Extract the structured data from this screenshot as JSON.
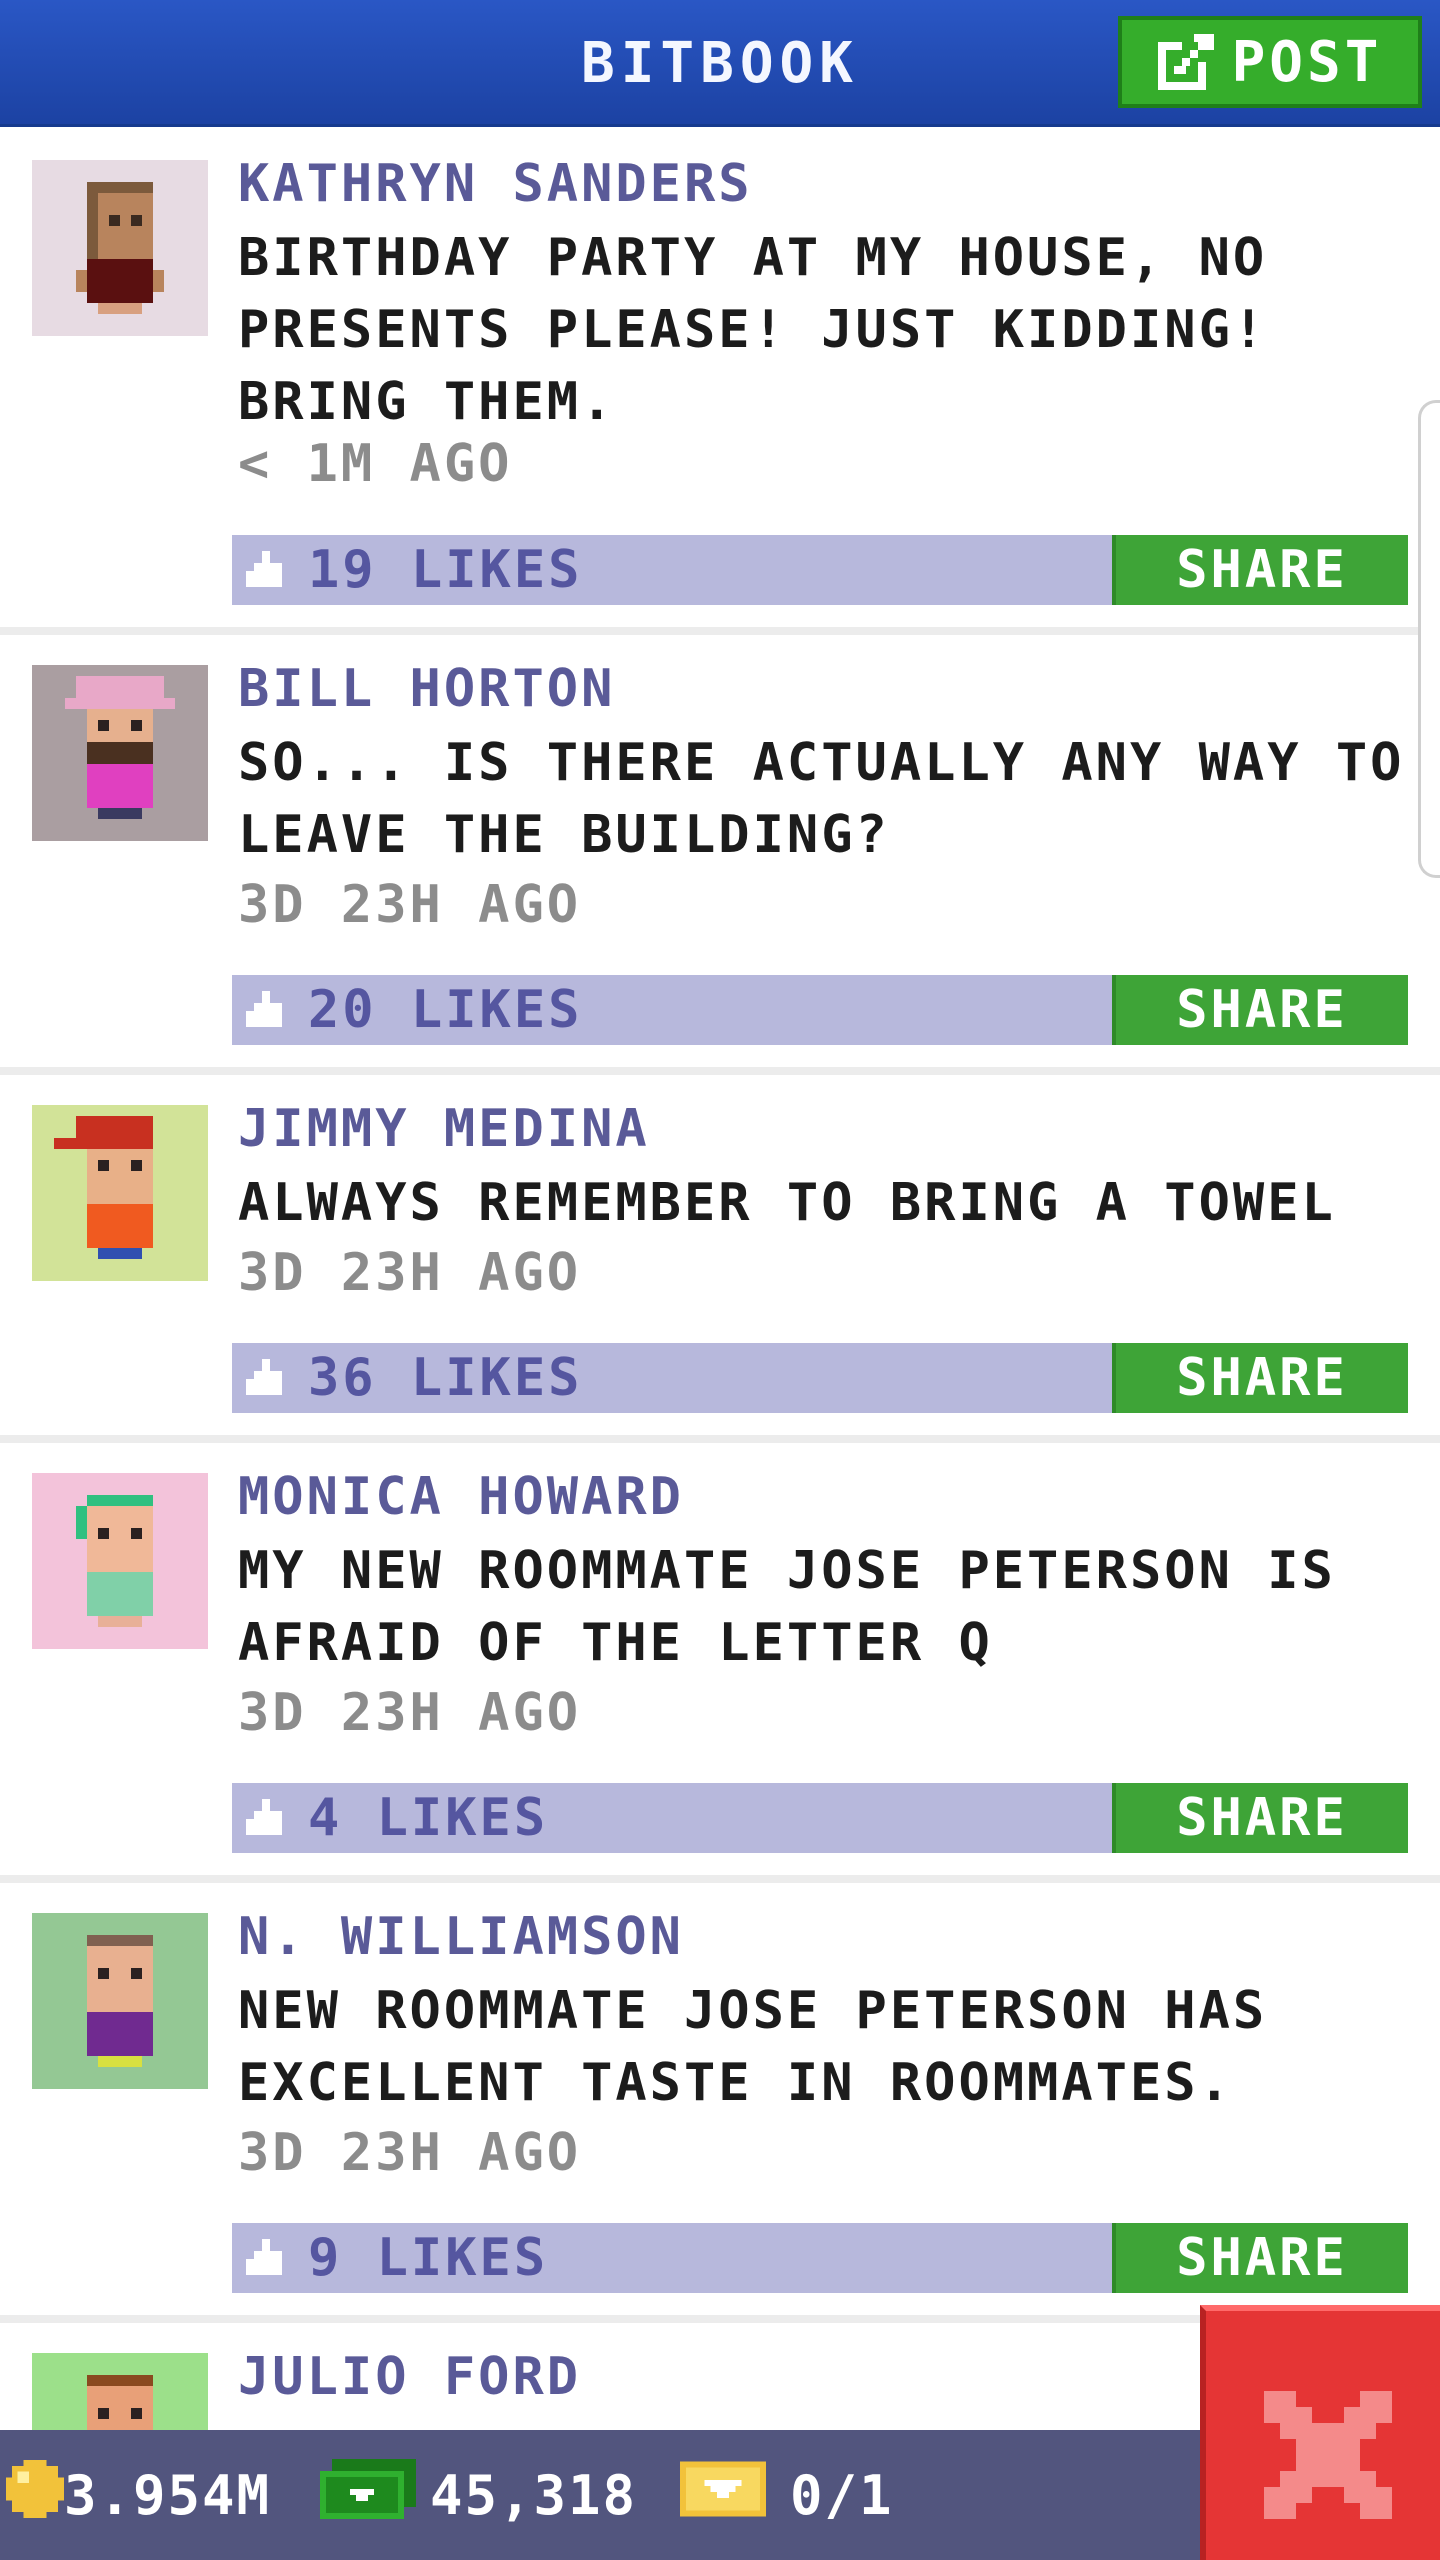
{
  "header": {
    "title": "BITBOOK",
    "post_label": "POST"
  },
  "posts": [
    {
      "name": "KATHRYN SANDERS",
      "text": "BIRTHDAY PARTY AT MY HOUSE, NO PRESENTS PLEASE! JUST KIDDING! BRING THEM.",
      "time": "< 1M AGO",
      "likes": "19 LIKES",
      "share_label": "SHARE",
      "avatar_bg": "#e7dbe3"
    },
    {
      "name": "BILL HORTON",
      "text": "SO... IS THERE ACTUALLY ANY WAY TO LEAVE THE BUILDING?",
      "time": "3D 23H AGO",
      "likes": "20 LIKES",
      "share_label": "SHARE",
      "avatar_bg": "#aa9ea1"
    },
    {
      "name": "JIMMY MEDINA",
      "text": "ALWAYS REMEMBER TO BRING A TOWEL",
      "time": "3D 23H AGO",
      "likes": "36 LIKES",
      "share_label": "SHARE",
      "avatar_bg": "#d2e398"
    },
    {
      "name": "MONICA HOWARD",
      "text": "MY NEW ROOMMATE JOSE PETERSON IS AFRAID OF THE LETTER Q",
      "time": "3D 23H AGO",
      "likes": "4 LIKES",
      "share_label": "SHARE",
      "avatar_bg": "#f3c3da"
    },
    {
      "name": "N. WILLIAMSON",
      "text": "NEW ROOMMATE JOSE PETERSON HAS EXCELLENT TASTE IN ROOMMATES.",
      "time": "3D 23H AGO",
      "likes": "9 LIKES",
      "share_label": "SHARE",
      "avatar_bg": "#94c894"
    },
    {
      "name": "JULIO FORD",
      "text": "",
      "time": "",
      "likes": "",
      "share_label": "",
      "avatar_bg": "#9ce08a"
    }
  ],
  "footer": {
    "coins": "3.954M",
    "bux": "45,318",
    "tickets": "0/1"
  },
  "colors": {
    "header_blue": "#2a57c5",
    "post_green": "#35ad2b",
    "like_bar": "#b7b8dc",
    "name_purple": "#5a5a98",
    "close_red": "#e53535",
    "footer_bg": "#52557e"
  }
}
